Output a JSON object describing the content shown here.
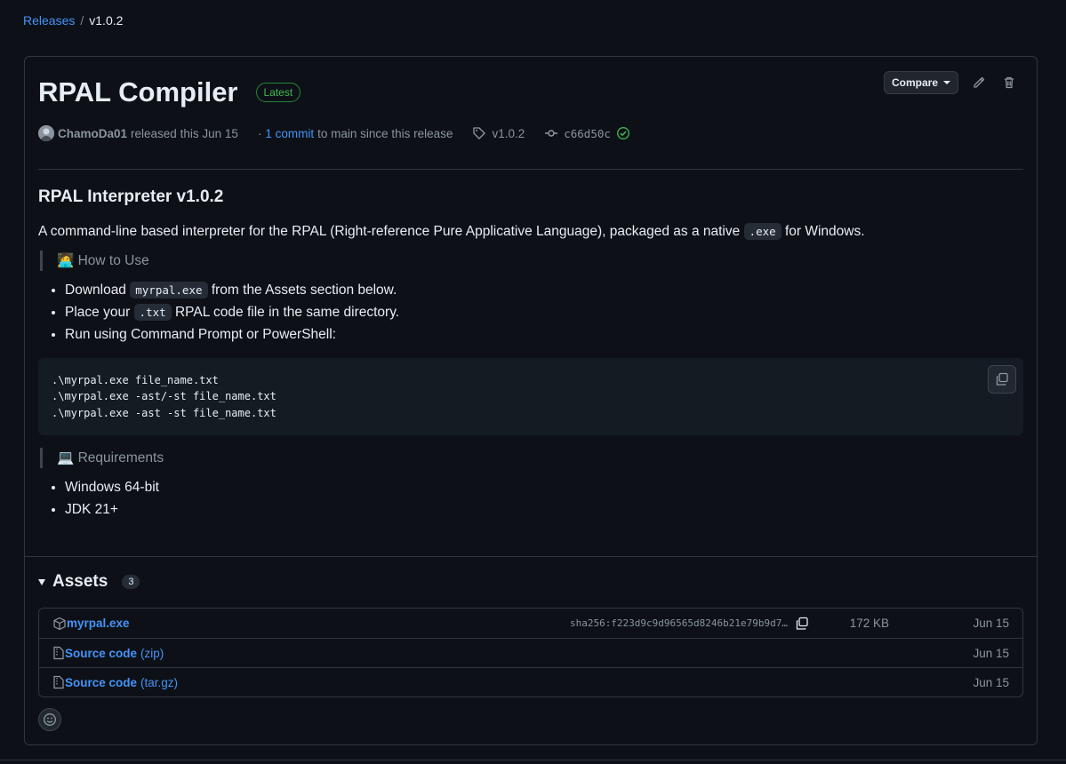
{
  "breadcrumb": {
    "parent": "Releases",
    "separator": "/",
    "current": "v1.0.2"
  },
  "release": {
    "title": "RPAL Compiler",
    "badge": "Latest",
    "compare_label": "Compare",
    "author": "ChamoDa01",
    "released_text": "released this Jun 15",
    "commit_prefix": "·",
    "commit_link": "1 commit",
    "commit_suffix": "to main since this release",
    "tag": "v1.0.2",
    "commit_sha": "c66d50c"
  },
  "notes": {
    "heading": "RPAL Interpreter v1.0.2",
    "intro_before": "A command-line based interpreter for the RPAL (Right-reference Pure Applicative Language), packaged as a native",
    "intro_code": ".exe",
    "intro_after": "for Windows.",
    "how_to_use": "🧑‍💻 How to Use",
    "steps": [
      {
        "before": "Download",
        "code": "myrpal.exe",
        "after": "from the Assets section below."
      },
      {
        "before": "Place your",
        "code": ".txt",
        "after": "RPAL code file in the same directory."
      },
      {
        "text": "Run using Command Prompt or PowerShell:"
      }
    ],
    "code_lines": [
      ".\\myrpal.exe file_name.txt",
      ".\\myrpal.exe -ast/-st file_name.txt",
      ".\\myrpal.exe -ast -st file_name.txt"
    ],
    "requirements": "💻 Requirements",
    "req_items": [
      "Windows 64-bit",
      "JDK 21+"
    ]
  },
  "assets": {
    "label": "Assets",
    "count": "3",
    "items": [
      {
        "name": "myrpal.exe",
        "sha": "sha256:f223d9c9d96565d8246b21e79b9d7…",
        "size": "172 KB",
        "date": "Jun 15"
      },
      {
        "name": "Source code",
        "suffix": "(zip)",
        "date": "Jun 15"
      },
      {
        "name": "Source code",
        "suffix": "(tar.gz)",
        "date": "Jun 15"
      }
    ]
  },
  "colors": {
    "accent": "#4493f8",
    "success": "#3fb950",
    "background": "#0d1117",
    "border": "#30363d"
  },
  "icons": [
    "pencil-icon",
    "trash-icon",
    "tag-icon",
    "commit-icon",
    "verified-check-icon",
    "package-icon",
    "file-zip-icon",
    "copy-icon",
    "smiley-icon"
  ]
}
